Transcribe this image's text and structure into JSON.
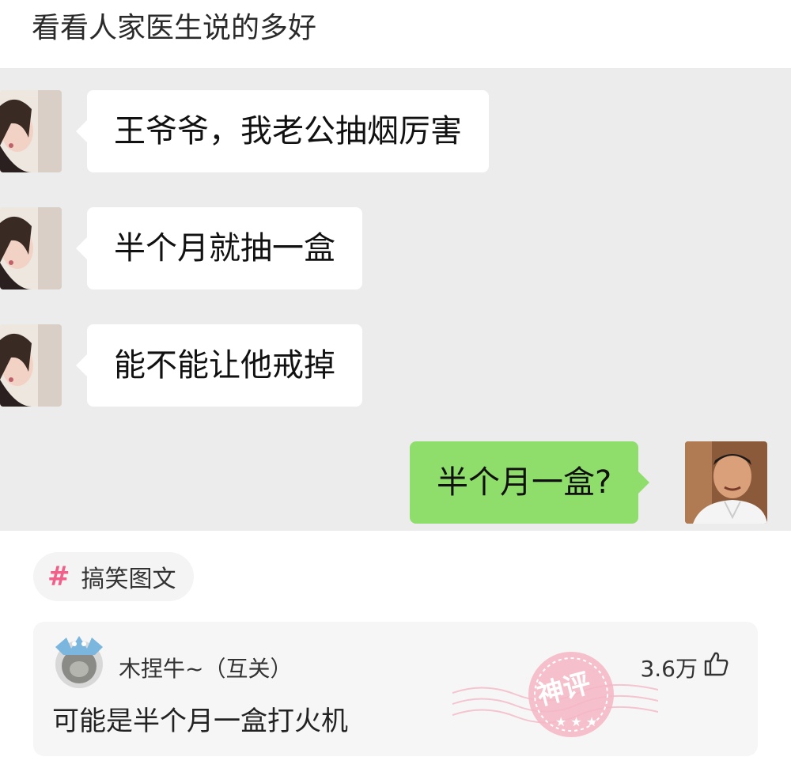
{
  "post": {
    "title": "看看人家医生说的多好"
  },
  "chat": {
    "messages": [
      {
        "side": "in",
        "text": "王爷爷，我老公抽烟厉害"
      },
      {
        "side": "in",
        "text": "半个月就抽一盒"
      },
      {
        "side": "in",
        "text": "能不能让他戒掉"
      },
      {
        "side": "out",
        "text": "半个月一盒?"
      }
    ],
    "colors": {
      "background": "#ececec",
      "incoming_bubble": "#ffffff",
      "outgoing_bubble": "#8fde6b"
    }
  },
  "topic": {
    "hash": "#",
    "label": "搞笑图文",
    "hash_color": "#f0608a"
  },
  "comment": {
    "username": "木捏牛~（互关）",
    "likes": "3.6万",
    "text": "可能是半个月一盒打火机",
    "badge": "神评",
    "icons": {
      "like": "thumbs-up-icon",
      "badge": "hot-comment-stamp-icon"
    }
  }
}
